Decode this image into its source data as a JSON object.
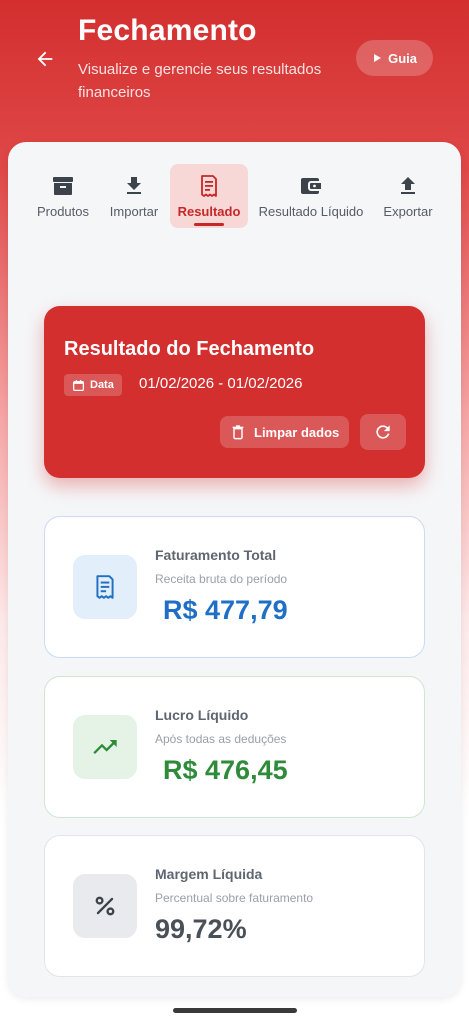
{
  "header": {
    "title": "Fechamento",
    "subtitle": "Visualize e gerencie seus resultados financeiros",
    "guide_label": "Guia"
  },
  "tabs": [
    {
      "label": "Produtos",
      "icon": "archive-box-icon",
      "active": false
    },
    {
      "label": "Importar",
      "icon": "download-icon",
      "active": false
    },
    {
      "label": "Resultado",
      "icon": "receipt-icon",
      "active": true
    },
    {
      "label": "Resultado Líquido",
      "icon": "wallet-icon",
      "active": false
    },
    {
      "label": "Exportar",
      "icon": "upload-icon",
      "active": false
    }
  ],
  "result_card": {
    "title": "Resultado do Fechamento",
    "date_chip_label": "Data",
    "date_range": "01/02/2026 - 01/02/2026",
    "clear_label": "Limpar dados"
  },
  "metrics": [
    {
      "title": "Faturamento Total",
      "subtitle": "Receita bruta do período",
      "value": "R$ 477,79",
      "icon": "receipt-icon"
    },
    {
      "title": "Lucro Líquido",
      "subtitle": "Após todas as deduções",
      "value": "R$ 476,45",
      "icon": "trending-up-icon"
    },
    {
      "title": "Margem Líquida",
      "subtitle": "Percentual sobre faturamento",
      "value": "99,72%",
      "icon": "percent-icon"
    }
  ],
  "colors": {
    "primary": "#d32f2f",
    "revenue": "#1e6fc5",
    "profit": "#2e8b3a",
    "margin": "#4a5058"
  }
}
